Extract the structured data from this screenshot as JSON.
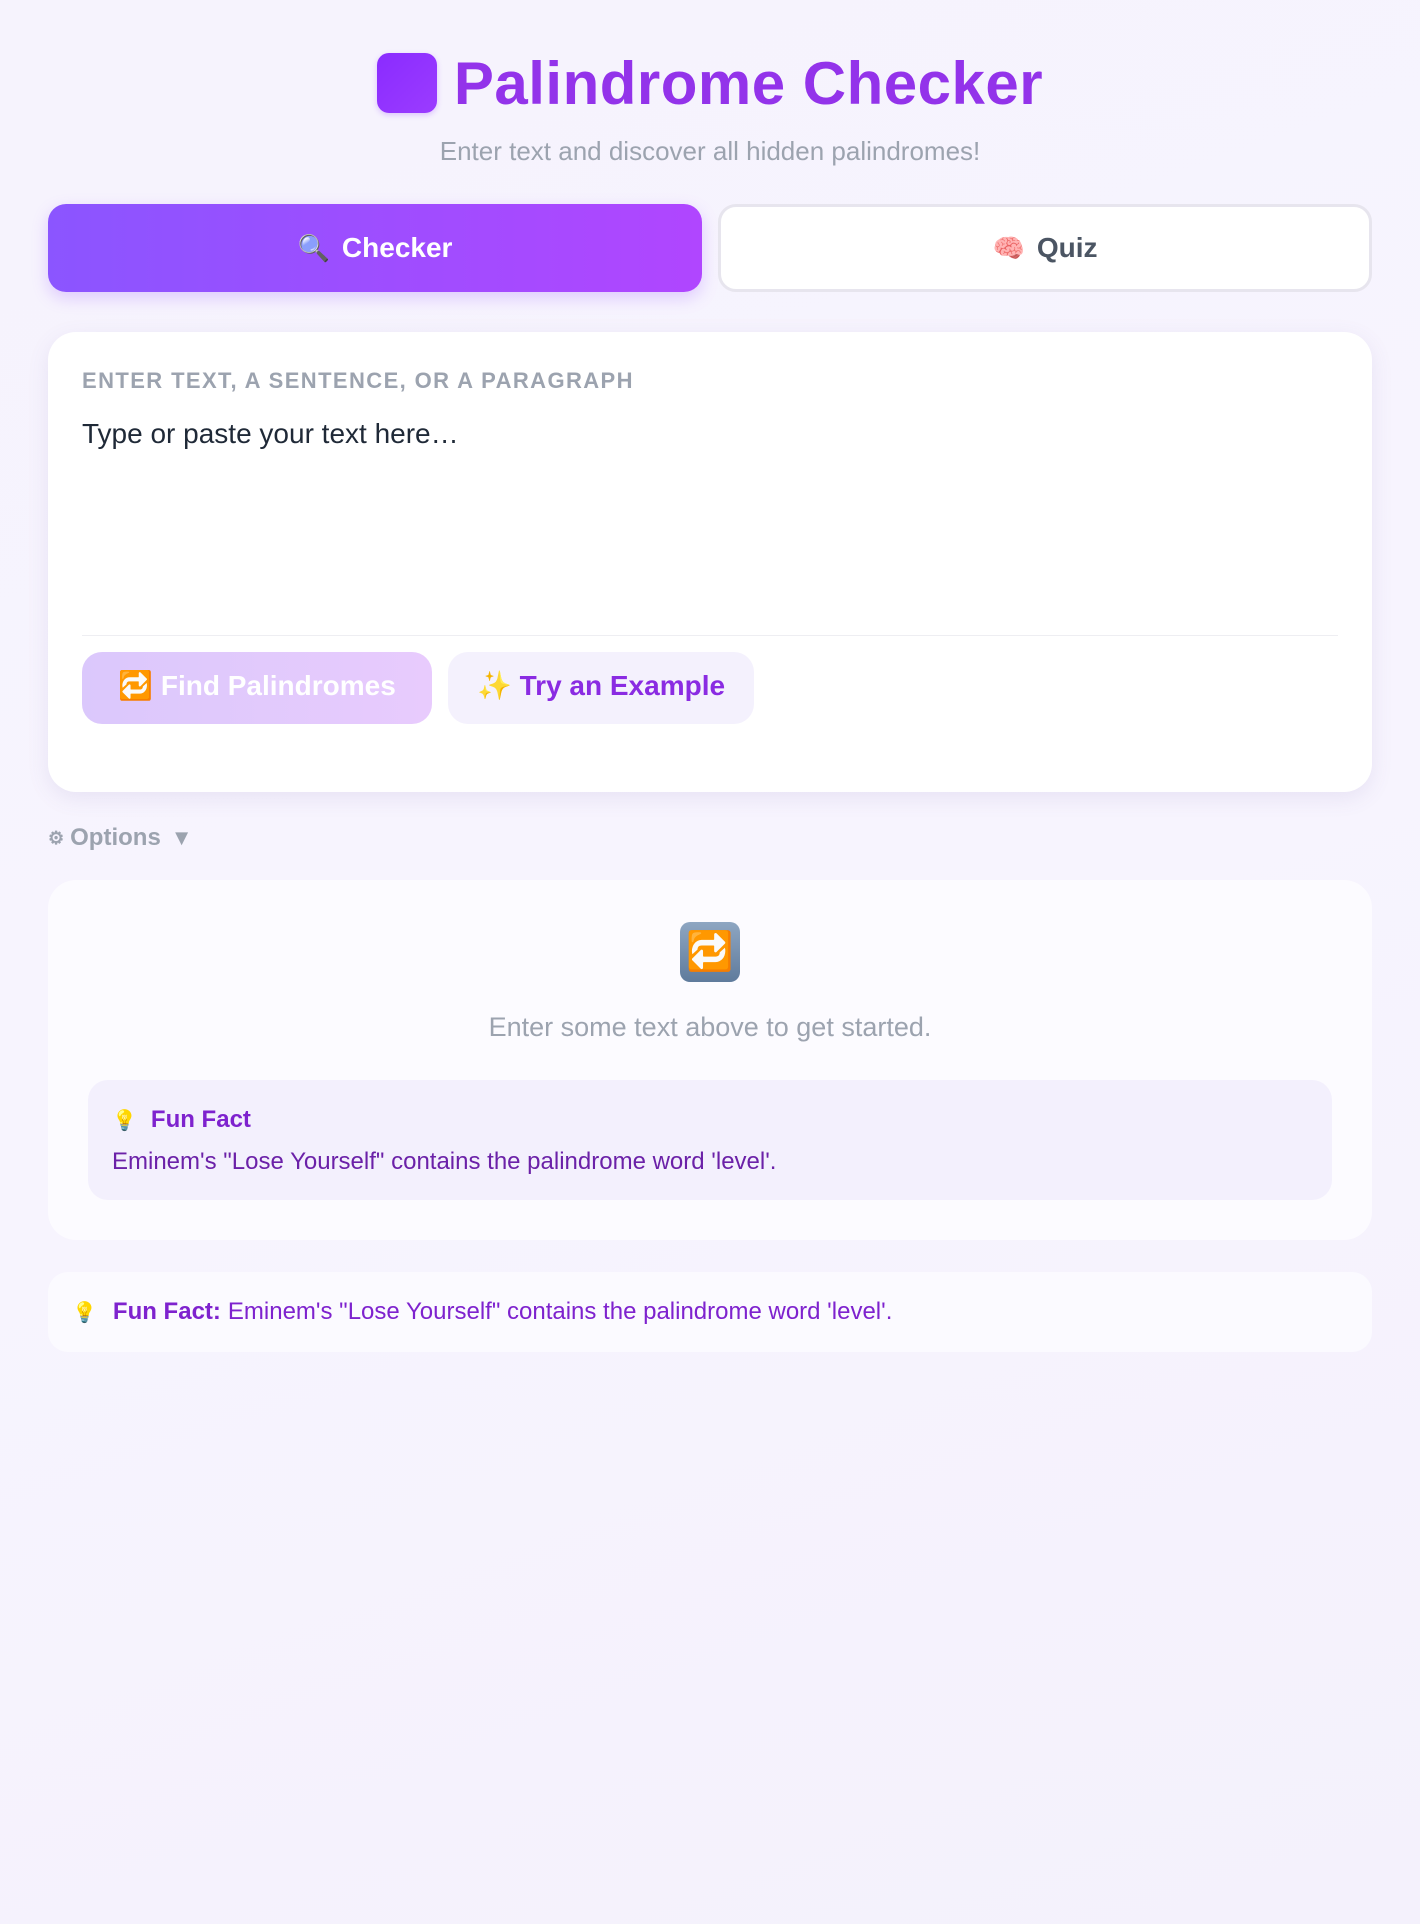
{
  "header": {
    "title": "Palindrome Checker",
    "subtitle": "Enter text and discover all hidden palindromes!"
  },
  "tabs": [
    {
      "icon": "🔍",
      "label": "Checker",
      "active": true
    },
    {
      "icon": "🧠",
      "label": "Quiz",
      "active": false
    }
  ],
  "input": {
    "label": "ENTER TEXT, A SENTENCE, OR A PARAGRAPH",
    "placeholder": "Type or paste your text here…",
    "value": ""
  },
  "buttons": {
    "find_icon": "🔁",
    "find_label": "Find Palindromes",
    "example_icon": "✨",
    "example_label": "Try an Example"
  },
  "options": {
    "icon": "⚙",
    "label": "Options",
    "caret": "▼"
  },
  "result": {
    "icon": "🔁",
    "empty_text": "Enter some text above to get started.",
    "fun_fact": {
      "icon": "💡",
      "title": "Fun Fact",
      "text": "Eminem's \"Lose Yourself\" contains the palindrome word 'level'."
    }
  },
  "banner": {
    "icon": "💡",
    "label": "Fun Fact:",
    "text": "Eminem's \"Lose Yourself\" contains the palindrome word 'level'."
  },
  "colors": {
    "accent": "#9333ea",
    "tab_active_start": "#8b55ff",
    "tab_active_end": "#b046ff",
    "muted": "#9ca3af"
  }
}
